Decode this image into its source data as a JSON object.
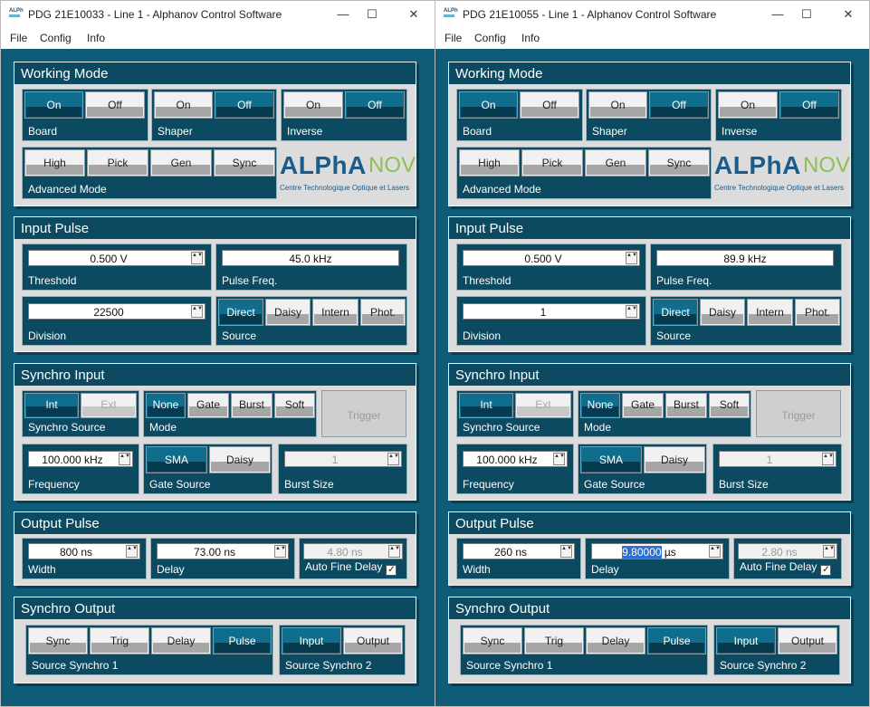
{
  "windows": [
    {
      "title": "PDG 21E10033 - Line 1 - Alphanov Control Software",
      "menu": [
        "File",
        "Config",
        "Info"
      ],
      "working_mode": {
        "title": "Working Mode",
        "board_label": "Board",
        "shaper_label": "Shaper",
        "inverse_label": "Inverse",
        "advanced_label": "Advanced Mode",
        "on": "On",
        "off": "Off",
        "high": "High",
        "pick": "Pick",
        "gen": "Gen",
        "sync": "Sync"
      },
      "logo": {
        "main": "ALPhA",
        "accent": "NOV",
        "sub": "Centre Technologique Optique et Lasers"
      },
      "input_pulse": {
        "title": "Input Pulse",
        "threshold": "0.500 V",
        "threshold_label": "Threshold",
        "pulse_freq": "45.0 kHz",
        "pulse_freq_label": "Pulse Freq.",
        "division": "22500",
        "division_label": "Division",
        "source_label": "Source",
        "direct": "Direct",
        "daisy": "Daisy",
        "intern": "Intern",
        "phot": "Phot."
      },
      "synchro_input": {
        "title": "Synchro Input",
        "int": "Int",
        "ext": "Ext",
        "source_label": "Synchro Source",
        "none": "None",
        "gate": "Gate",
        "burst": "Burst",
        "soft": "Soft",
        "mode_label": "Mode",
        "trigger": "Trigger",
        "frequency": "100.000 kHz",
        "frequency_label": "Frequency",
        "sma": "SMA",
        "daisy": "Daisy",
        "gate_source_label": "Gate Source",
        "burst_size": "1",
        "burst_size_label": "Burst Size"
      },
      "output_pulse": {
        "title": "Output Pulse",
        "width": "800 ns",
        "width_label": "Width",
        "delay": "73.00 ns",
        "delay_label": "Delay",
        "fine_delay": "4.80 ns",
        "fine_delay_label": "Auto Fine Delay",
        "check": "✓"
      },
      "synchro_output": {
        "title": "Synchro Output",
        "sync": "Sync",
        "trig": "Trig",
        "delay": "Delay",
        "pulse": "Pulse",
        "src1_label": "Source Synchro 1",
        "input": "Input",
        "output": "Output",
        "src2_label": "Source Synchro 2"
      }
    },
    {
      "title": "PDG 21E10055 - Line 1 - Alphanov Control Software",
      "menu": [
        "File",
        "Config",
        "Info"
      ],
      "working_mode": {
        "title": "Working Mode",
        "board_label": "Board",
        "shaper_label": "Shaper",
        "inverse_label": "Inverse",
        "advanced_label": "Advanced Mode",
        "on": "On",
        "off": "Off",
        "high": "High",
        "pick": "Pick",
        "gen": "Gen",
        "sync": "Sync"
      },
      "logo": {
        "main": "ALPhA",
        "accent": "NOV",
        "sub": "Centre Technologique Optique et Lasers"
      },
      "input_pulse": {
        "title": "Input Pulse",
        "threshold": "0.500 V",
        "threshold_label": "Threshold",
        "pulse_freq": "89.9 kHz",
        "pulse_freq_label": "Pulse Freq.",
        "division": "1",
        "division_label": "Division",
        "source_label": "Source",
        "direct": "Direct",
        "daisy": "Daisy",
        "intern": "Intern",
        "phot": "Phot."
      },
      "synchro_input": {
        "title": "Synchro Input",
        "int": "Int",
        "ext": "Ext",
        "source_label": "Synchro Source",
        "none": "None",
        "gate": "Gate",
        "burst": "Burst",
        "soft": "Soft",
        "mode_label": "Mode",
        "trigger": "Trigger",
        "frequency": "100.000 kHz",
        "frequency_label": "Frequency",
        "sma": "SMA",
        "daisy": "Daisy",
        "gate_source_label": "Gate Source",
        "burst_size": "1",
        "burst_size_label": "Burst Size"
      },
      "output_pulse": {
        "title": "Output Pulse",
        "width": "260 ns",
        "width_label": "Width",
        "delay_selected": "9.80000",
        "delay_unit": " µs",
        "delay_label": "Delay",
        "fine_delay": "2.80 ns",
        "fine_delay_label": "Auto Fine Delay",
        "check": "✓"
      },
      "synchro_output": {
        "title": "Synchro Output",
        "sync": "Sync",
        "trig": "Trig",
        "delay": "Delay",
        "pulse": "Pulse",
        "src1_label": "Source Synchro 1",
        "input": "Input",
        "output": "Output",
        "src2_label": "Source Synchro 2"
      }
    }
  ],
  "window_controls": {
    "minimize": "—",
    "maximize": "☐",
    "close": "✕"
  },
  "spin_arrows": "▲▼",
  "colors": {
    "app_bg": "#0e5c78",
    "group_bg": "#0b4a61",
    "active_button": "#0f6e8d",
    "logo_blue": "#1c5c8b",
    "logo_green": "#8cc152"
  }
}
